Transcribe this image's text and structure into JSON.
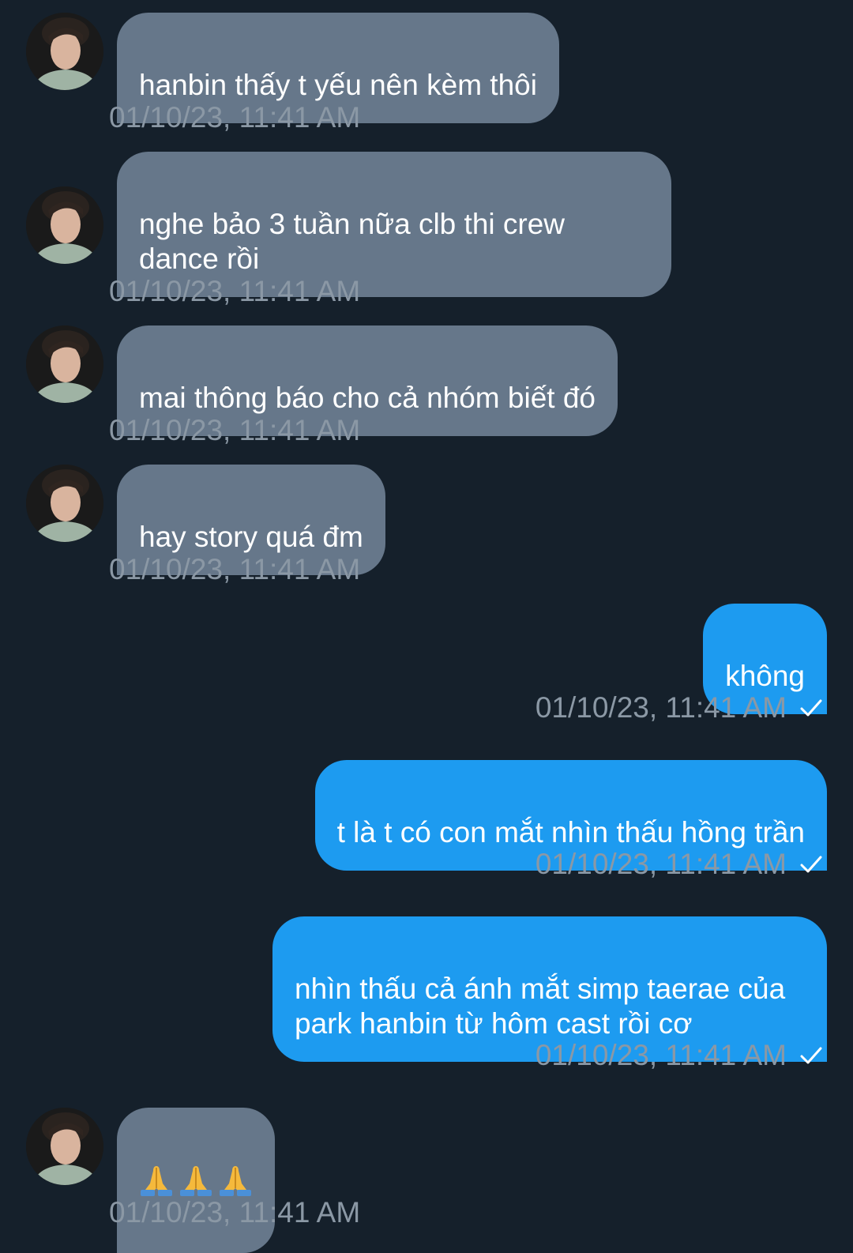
{
  "conversation": {
    "messages": [
      {
        "direction": "in",
        "text": "hanbin thấy t yếu nên kèm thôi",
        "time": "01/10/23, 11:41 AM"
      },
      {
        "direction": "in",
        "text": "nghe bảo 3 tuần nữa clb thi crew\ndance rồi",
        "time": "01/10/23, 11:41 AM"
      },
      {
        "direction": "in",
        "text": "mai thông báo cho cả nhóm biết đó",
        "time": "01/10/23, 11:41 AM"
      },
      {
        "direction": "in",
        "text": "hay story quá đm",
        "time": "01/10/23, 11:41 AM"
      },
      {
        "direction": "out",
        "text": "không",
        "time": "01/10/23, 11:41 AM",
        "status_icon": "check-icon"
      },
      {
        "direction": "out",
        "text": "t là t có con mắt nhìn thấu hồng trần",
        "time": "01/10/23, 11:41 AM",
        "status_icon": "check-icon"
      },
      {
        "direction": "out",
        "text": "nhìn thấu cả ánh mắt simp taerae của\npark hanbin từ hôm cast rồi cơ",
        "time": "01/10/23, 11:41 AM",
        "status_icon": "check-icon"
      },
      {
        "direction": "in",
        "emoji": [
          "folded-hands-emoji",
          "folded-hands-emoji",
          "folded-hands-emoji"
        ],
        "time": "01/10/23, 11:41 AM"
      }
    ]
  },
  "colors": {
    "background": "#15202b",
    "incoming_bubble": "#66778a",
    "outgoing_bubble": "#1d9bf0",
    "timestamp": "#8b98a5"
  }
}
